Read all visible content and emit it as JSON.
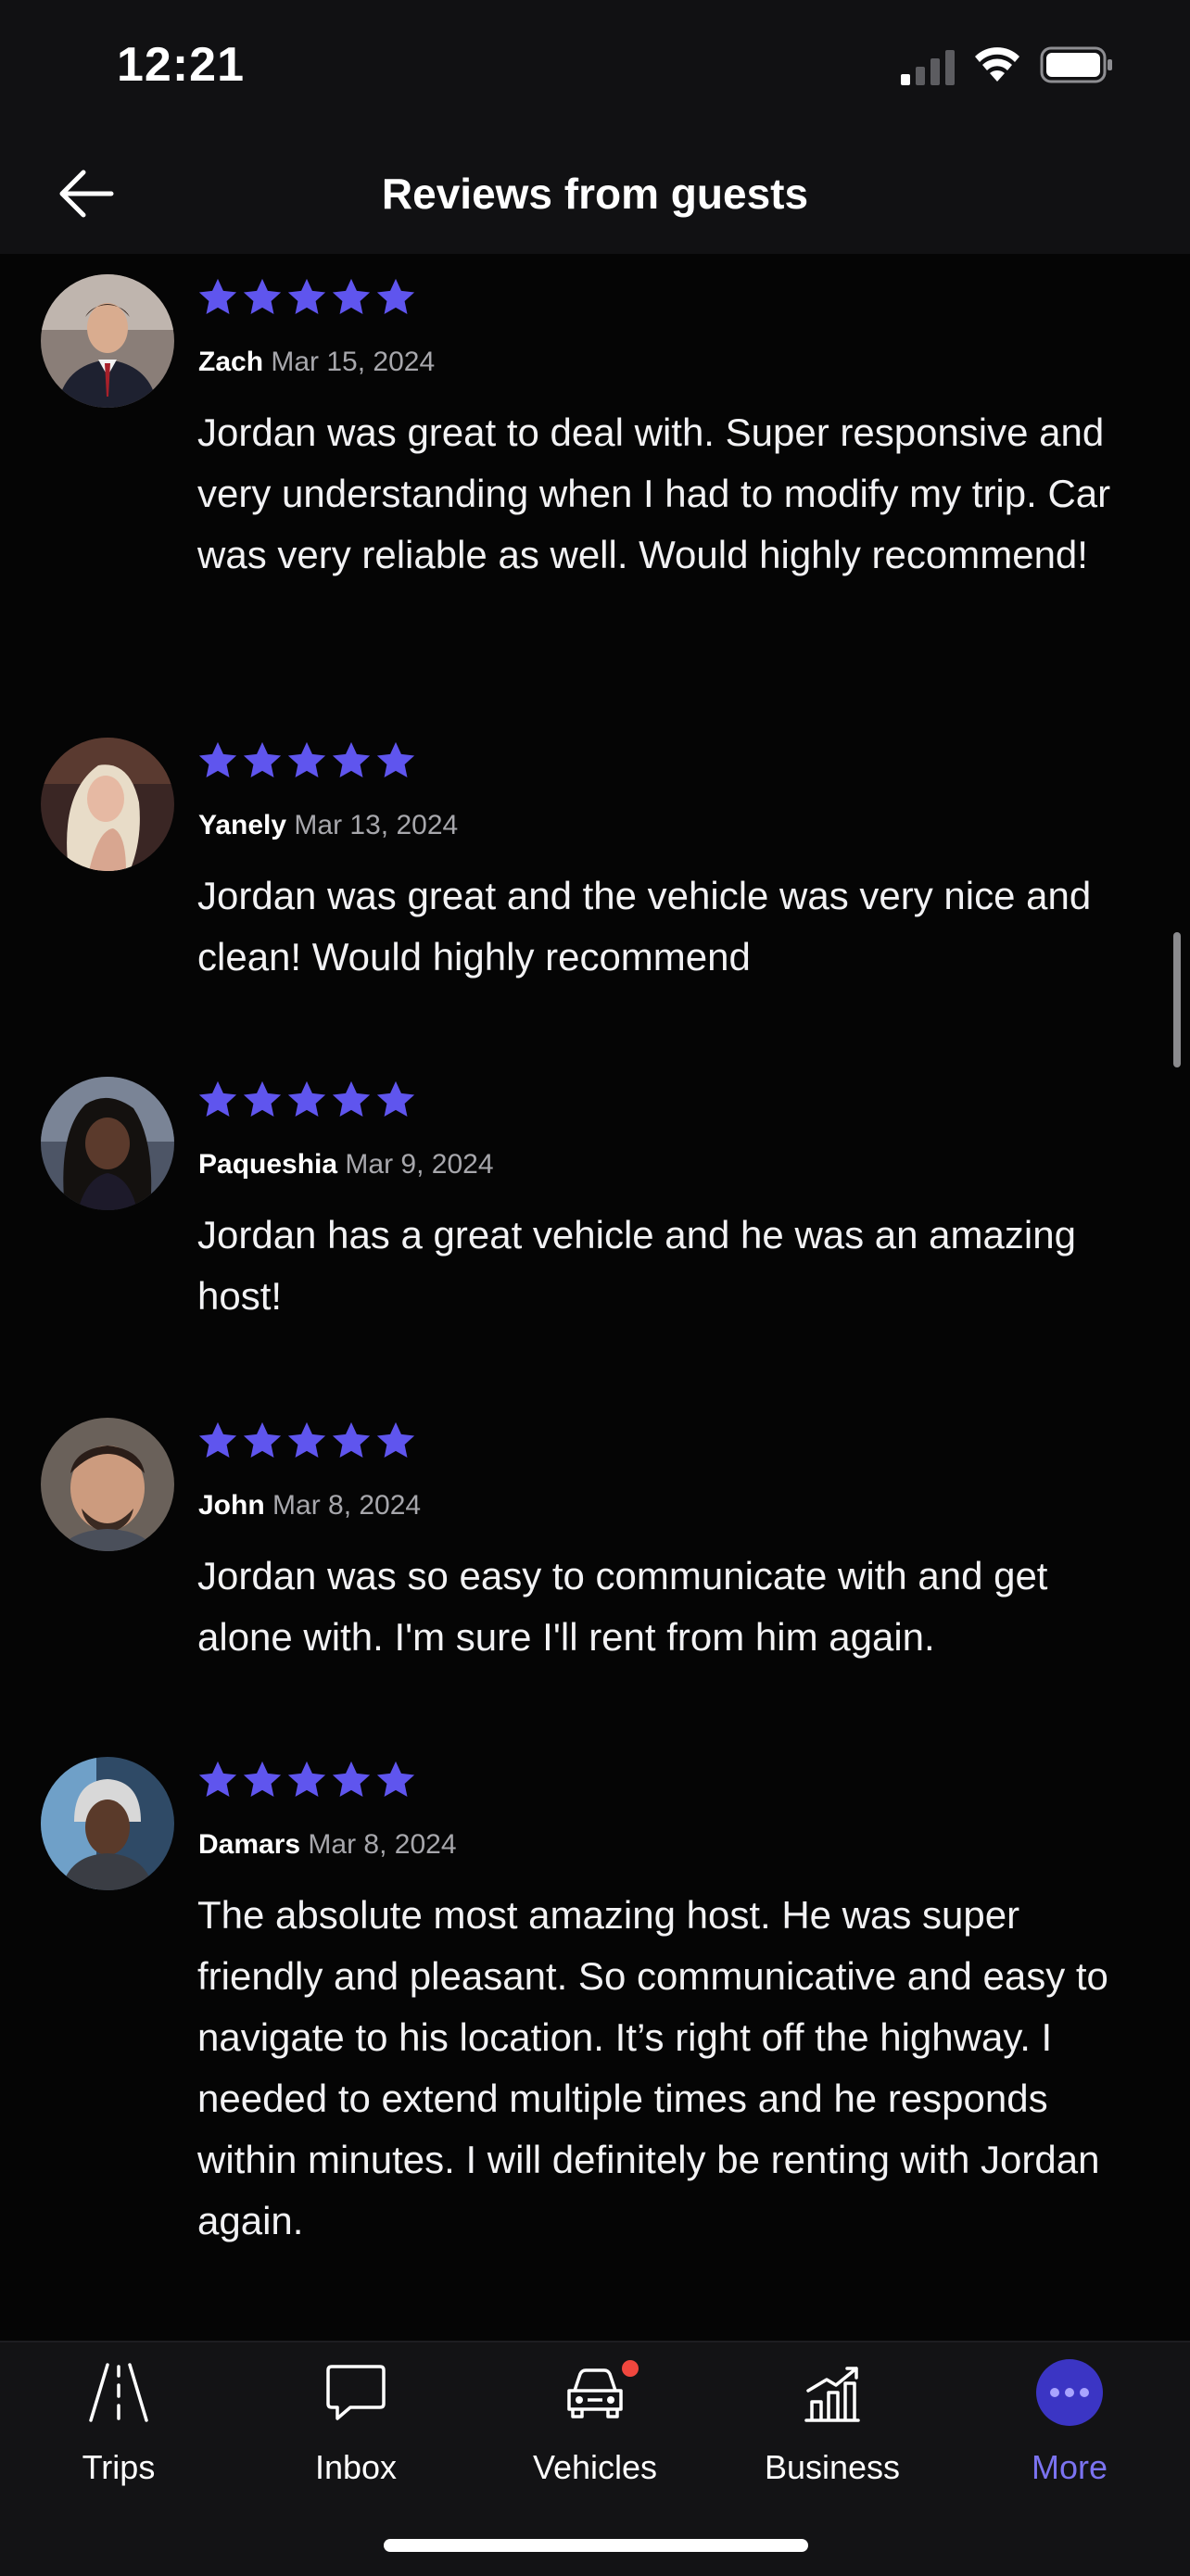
{
  "status_bar": {
    "time": "12:21"
  },
  "header": {
    "title": "Reviews from guests"
  },
  "reviews": [
    {
      "name": "Zach",
      "date": "Mar 15, 2024",
      "rating": 5,
      "text": "Jordan was great to deal with. Super responsive and very understanding when I had to modify my trip. Car was very reliable as well. Would highly recommend!"
    },
    {
      "name": "Yanely",
      "date": "Mar 13, 2024",
      "rating": 5,
      "text": "Jordan was great and the vehicle was very nice and clean! Would highly recommend"
    },
    {
      "name": "Paqueshia",
      "date": "Mar 9, 2024",
      "rating": 5,
      "text": "Jordan has a great vehicle and he was an amazing host!"
    },
    {
      "name": "John",
      "date": "Mar 8, 2024",
      "rating": 5,
      "text": "Jordan was so easy to communicate with and get alone with. I'm sure I'll rent from him again."
    },
    {
      "name": "Damars",
      "date": "Mar 8, 2024",
      "rating": 5,
      "text": "The absolute most amazing host. He was super friendly and pleasant. So communicative and easy to navigate to his location. It’s right off the highway. I needed to extend multiple times and he responds within minutes. I will definitely be renting with Jordan again."
    }
  ],
  "tab_bar": {
    "trips": "Trips",
    "inbox": "Inbox",
    "vehicles": "Vehicles",
    "business": "Business",
    "more": "More",
    "active_tab": "More"
  },
  "colors": {
    "star": "#5f55ee",
    "active_tab": "#7b73f0",
    "notification_dot": "#f0473e",
    "background": "#050505"
  },
  "icons": [
    "back-arrow-icon",
    "star-icon",
    "road-icon",
    "chat-bubble-icon",
    "car-icon",
    "bar-chart-icon",
    "more-dots-icon"
  ]
}
